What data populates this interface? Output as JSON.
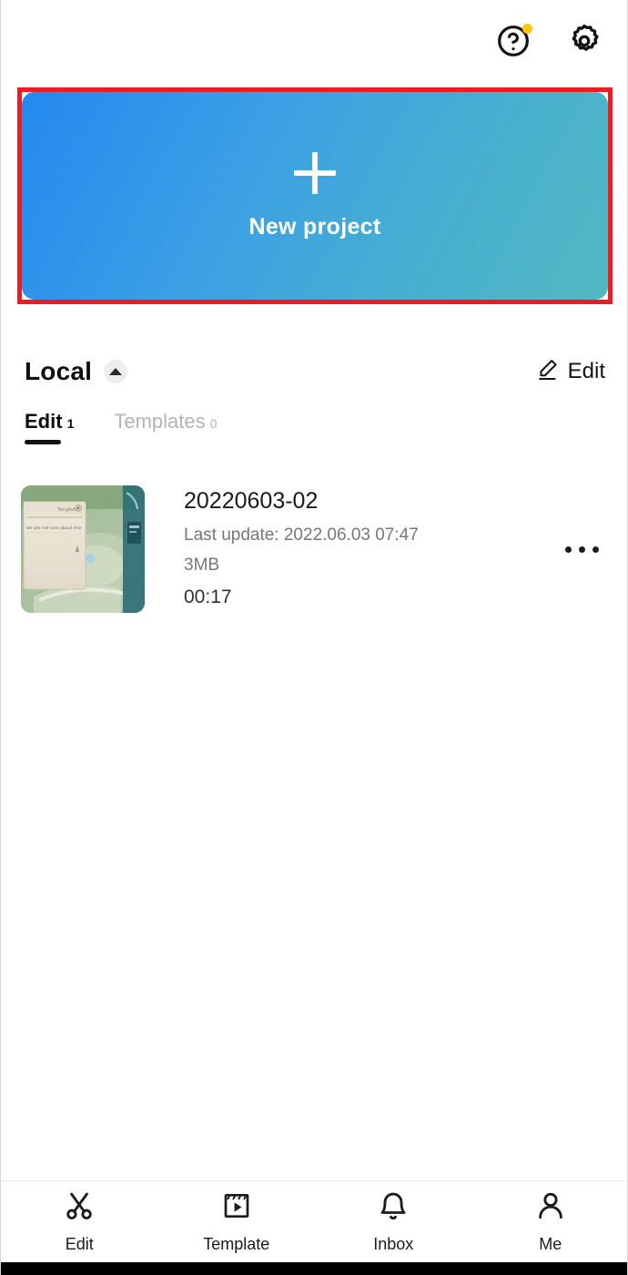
{
  "topbar": {
    "help_icon": "help-circle-icon",
    "settings_icon": "gear-icon",
    "has_notification_dot": true,
    "notification_dot_color": "#ffc60a"
  },
  "banner": {
    "label": "New project",
    "plus_icon": "plus-icon",
    "gradient_start": "#2489f0",
    "gradient_end": "#52b8c2",
    "highlight_border_color": "#ee1c21"
  },
  "local": {
    "title": "Local",
    "collapse_icon": "chevron-up-icon",
    "edit_action": {
      "label": "Edit",
      "icon": "pencil-icon"
    }
  },
  "tabs": [
    {
      "label": "Edit",
      "count": "1",
      "active": true
    },
    {
      "label": "Templates",
      "count": "0",
      "active": false
    }
  ],
  "project": {
    "title": "20220603-02",
    "last_update": "Last update: 2022.06.03 07:47",
    "size": "3MB",
    "duration": "00:17",
    "more_icon": "more-horizontal-icon",
    "thumbnail_alt": "game-screenshot-thumbnail"
  },
  "bottom_nav": [
    {
      "label": "Edit",
      "icon": "scissors-icon"
    },
    {
      "label": "Template",
      "icon": "film-play-icon"
    },
    {
      "label": "Inbox",
      "icon": "bell-icon"
    },
    {
      "label": "Me",
      "icon": "person-icon"
    }
  ]
}
